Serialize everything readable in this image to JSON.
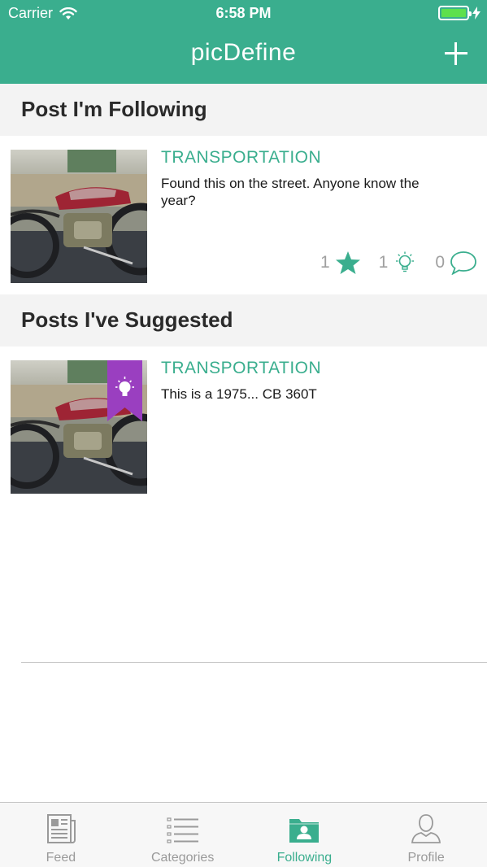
{
  "status_bar": {
    "carrier": "Carrier",
    "time": "6:58 PM"
  },
  "nav": {
    "title": "picDefine",
    "add_icon": "plus-icon"
  },
  "sections": [
    {
      "title": "Post I'm Following"
    },
    {
      "title": "Posts I've Suggested"
    }
  ],
  "following_post": {
    "category": "TRANSPORTATION",
    "caption": "Found this on the street. Anyone know the year?",
    "stars": "1",
    "suggestions": "1",
    "comments": "0"
  },
  "suggested_post": {
    "category": "TRANSPORTATION",
    "caption": "This is a 1975... CB 360T",
    "badge_icon": "lightbulb-bookmark-icon",
    "badge_color": "#9a3fc0"
  },
  "tabs": [
    {
      "label": "Feed",
      "icon": "newspaper-icon",
      "active": false
    },
    {
      "label": "Categories",
      "icon": "list-icon",
      "active": false
    },
    {
      "label": "Following",
      "icon": "folder-person-icon",
      "active": true
    },
    {
      "label": "Profile",
      "icon": "person-icon",
      "active": false
    }
  ],
  "colors": {
    "accent": "#3aae8e",
    "section_bg": "#f3f3f3",
    "battery": "#5de04d"
  }
}
